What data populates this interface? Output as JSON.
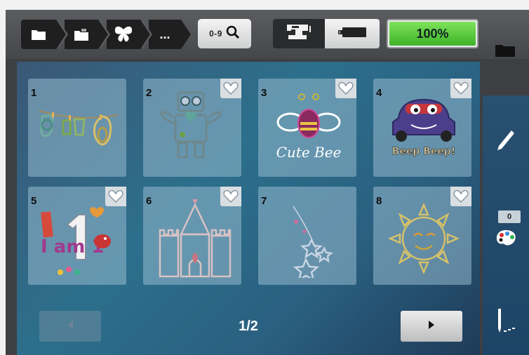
{
  "toolbar": {
    "breadcrumb": [
      {
        "icon": "folder-icon"
      },
      {
        "icon": "folder-open-icon"
      },
      {
        "icon": "butterfly-icon"
      },
      {
        "label": "..."
      }
    ],
    "search_label": "0-9",
    "search_icon": "magnifier-icon",
    "machine_icon": "sewing-machine-icon",
    "usb_icon": "usb-drive-icon",
    "memory_percent_label": "100%",
    "memory_fraction": 1.0,
    "memory_color": "#4fc23a"
  },
  "grid": {
    "tiles": [
      {
        "number": "1",
        "design": "baby-clothes-line",
        "favorite": false
      },
      {
        "number": "2",
        "design": "robot",
        "favorite": true
      },
      {
        "number": "3",
        "design": "cute-bee",
        "art_text": "Cute Bee",
        "favorite": true
      },
      {
        "number": "4",
        "design": "beep-car",
        "art_text": "Beep Beep!",
        "favorite": true
      },
      {
        "number": "5",
        "design": "i-am-1",
        "art_text": "I am 1",
        "favorite": true
      },
      {
        "number": "6",
        "design": "castle",
        "favorite": true
      },
      {
        "number": "7",
        "design": "stars",
        "favorite": false
      },
      {
        "number": "8",
        "design": "sun",
        "favorite": true
      }
    ]
  },
  "pager": {
    "page_label": "1/2"
  },
  "sidebar": {
    "color_count": "0"
  }
}
